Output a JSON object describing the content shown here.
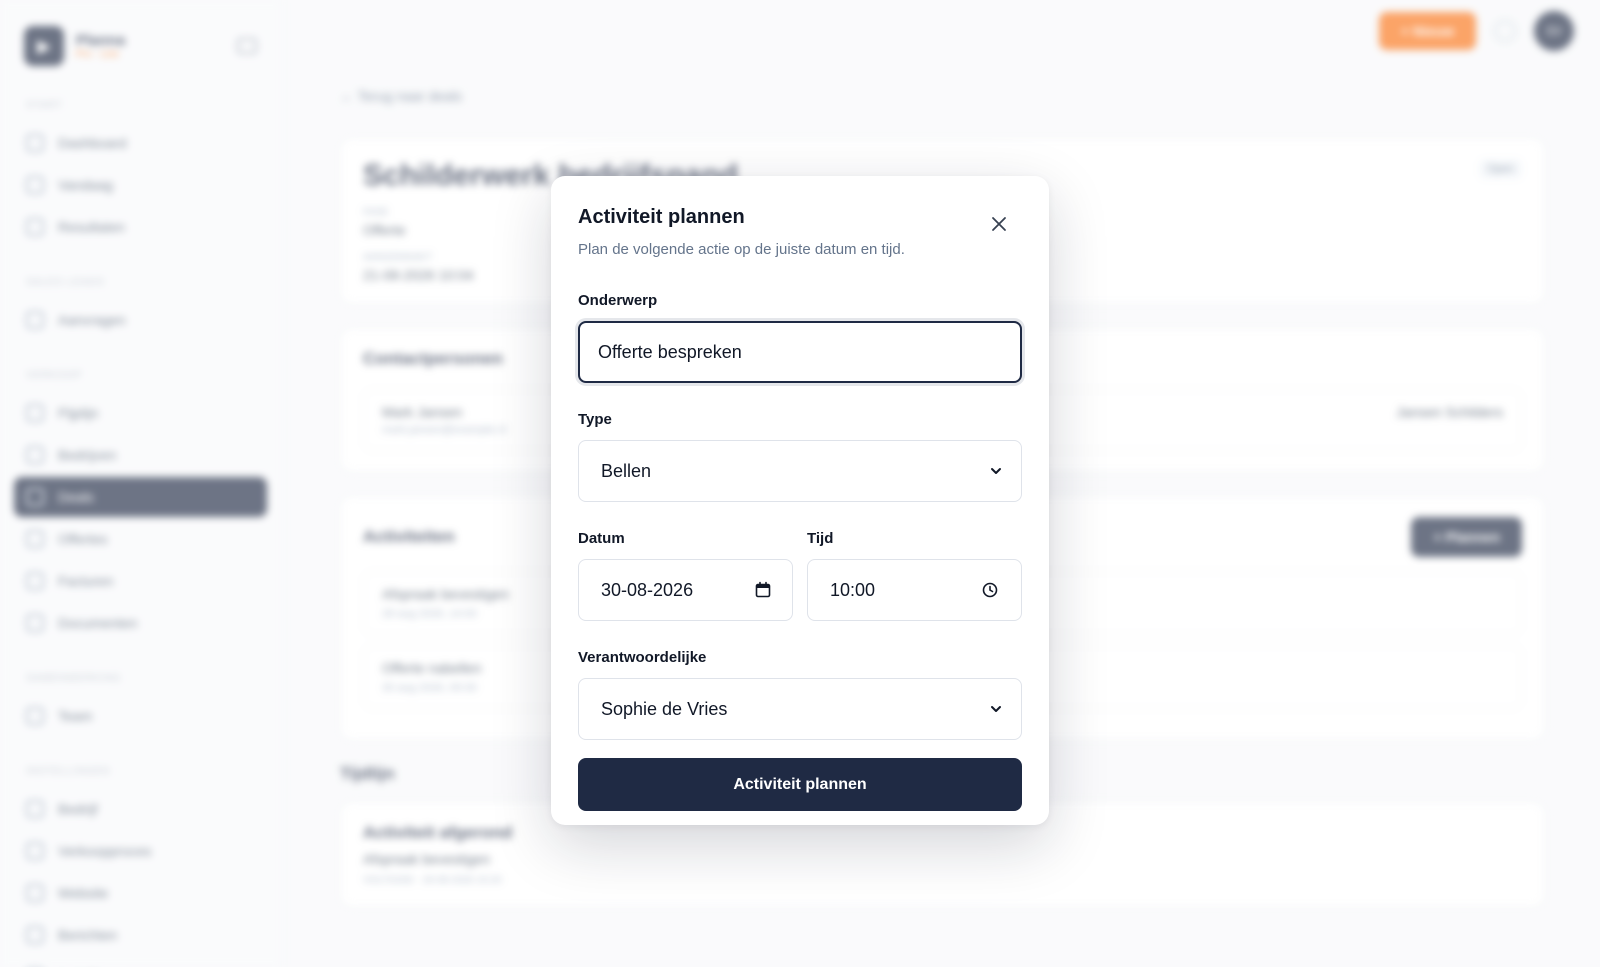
{
  "sidebar": {
    "brand_name": "Planna",
    "brand_sub": "Pro · Live",
    "sections": [
      {
        "title": "Start",
        "items": [
          "Dashboard",
          "Vandaag",
          "Resultaten"
        ]
      },
      {
        "title": "Sales leads",
        "items": [
          "Aanvragen"
        ]
      },
      {
        "title": "Verkoop",
        "items": [
          "Pijplijn",
          "Bedrijven",
          "Deals",
          "Offertes",
          "Facturen",
          "Documenten"
        ]
      },
      {
        "title": "Samenwerking",
        "items": [
          "Team"
        ]
      },
      {
        "title": "Instellingen",
        "items": [
          "Bedrijf",
          "Verkoopproces",
          "Website",
          "Berichten",
          "Instellingen"
        ]
      }
    ],
    "active_item": "Deals"
  },
  "topbar": {
    "new_label": "+ Nieuw",
    "avatar_initials": "SV"
  },
  "main": {
    "back_label": "← Terug naar deals",
    "deal_title": "Schilderwerk bedrijfspand",
    "badge": "Open",
    "fase_label": "Fase",
    "fase_value": "Offerte",
    "created_label": "Aangemaakt",
    "created_value": "21-08-2026 10:04",
    "contacts_title": "Contactpersonen",
    "contact_name": "Mark Jansen",
    "contact_email": "mark.jansen@example.nl",
    "contact_company": "Jansen Schilders",
    "activities_title": "Activiteiten",
    "plan_button": "+ Plannen",
    "activities": [
      {
        "title": "Afspraak bevestigen",
        "date": "28 aug 2026, 14:00"
      },
      {
        "title": "Offerte nabellen",
        "date": "30 aug 2026, 09:30"
      }
    ],
    "timeline_title": "Tijdlijn",
    "timeline_item_title": "Activiteit afgerond",
    "timeline_item_sub": "Afspraak bevestigen",
    "timeline_item_meta": "Voltooid · 26-08-2026 15:20"
  },
  "modal": {
    "title": "Activiteit plannen",
    "subtitle": "Plan de volgende actie op de juiste datum en tijd.",
    "subject_label": "Onderwerp",
    "subject_value": "Offerte bespreken",
    "type_label": "Type",
    "type_value": "Bellen",
    "date_label": "Datum",
    "date_value": "30-08-2026",
    "time_label": "Tijd",
    "time_value": "10:00",
    "owner_label": "Verantwoordelijke",
    "owner_value": "Sophie de Vries",
    "submit_label": "Activiteit plannen"
  },
  "colors": {
    "primary": "#1f2a44",
    "accent": "#f97316"
  },
  "icons": [
    "close-icon",
    "chevron-down-icon",
    "calendar-icon",
    "clock-icon"
  ]
}
